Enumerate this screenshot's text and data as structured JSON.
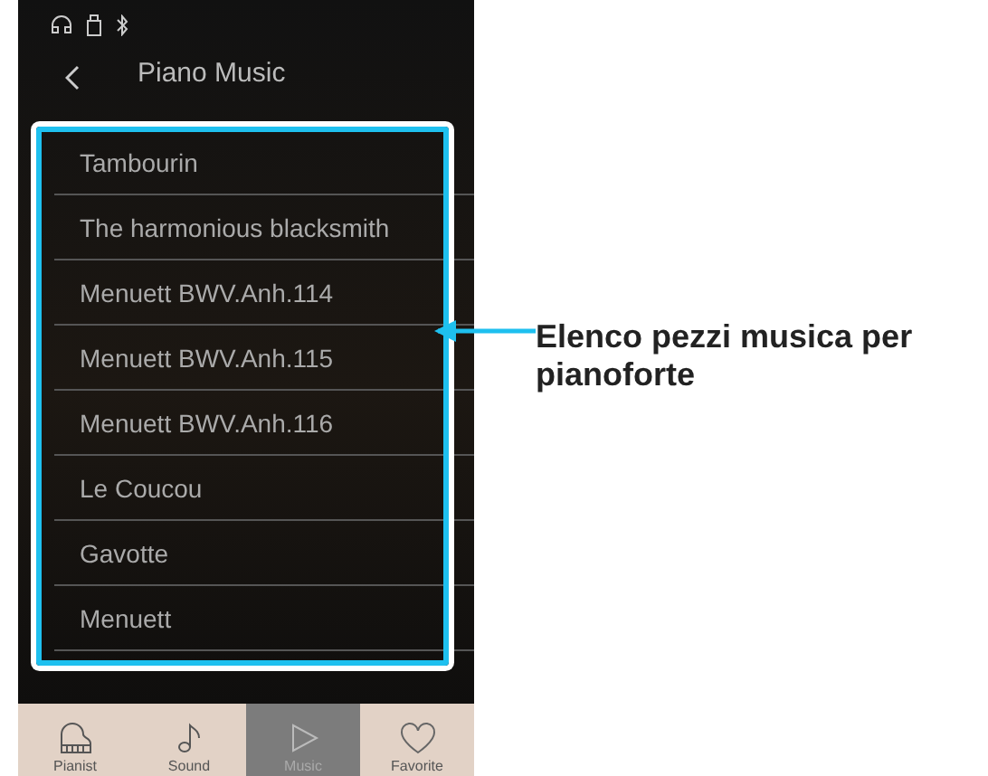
{
  "header": {
    "title": "Piano Music"
  },
  "pieces": [
    "Tambourin",
    "The harmonious blacksmith",
    "Menuett BWV.Anh.114",
    "Menuett BWV.Anh.115",
    "Menuett BWV.Anh.116",
    "Le Coucou",
    "Gavotte",
    "Menuett"
  ],
  "callout": "Elenco pezzi musica per pianoforte",
  "tabs": [
    {
      "label": "Pianist",
      "kind": "piano",
      "selected": false
    },
    {
      "label": "Sound",
      "kind": "note",
      "selected": false
    },
    {
      "label": "Music",
      "kind": "play",
      "selected": true
    },
    {
      "label": "Favorite",
      "kind": "heart",
      "selected": false
    }
  ]
}
